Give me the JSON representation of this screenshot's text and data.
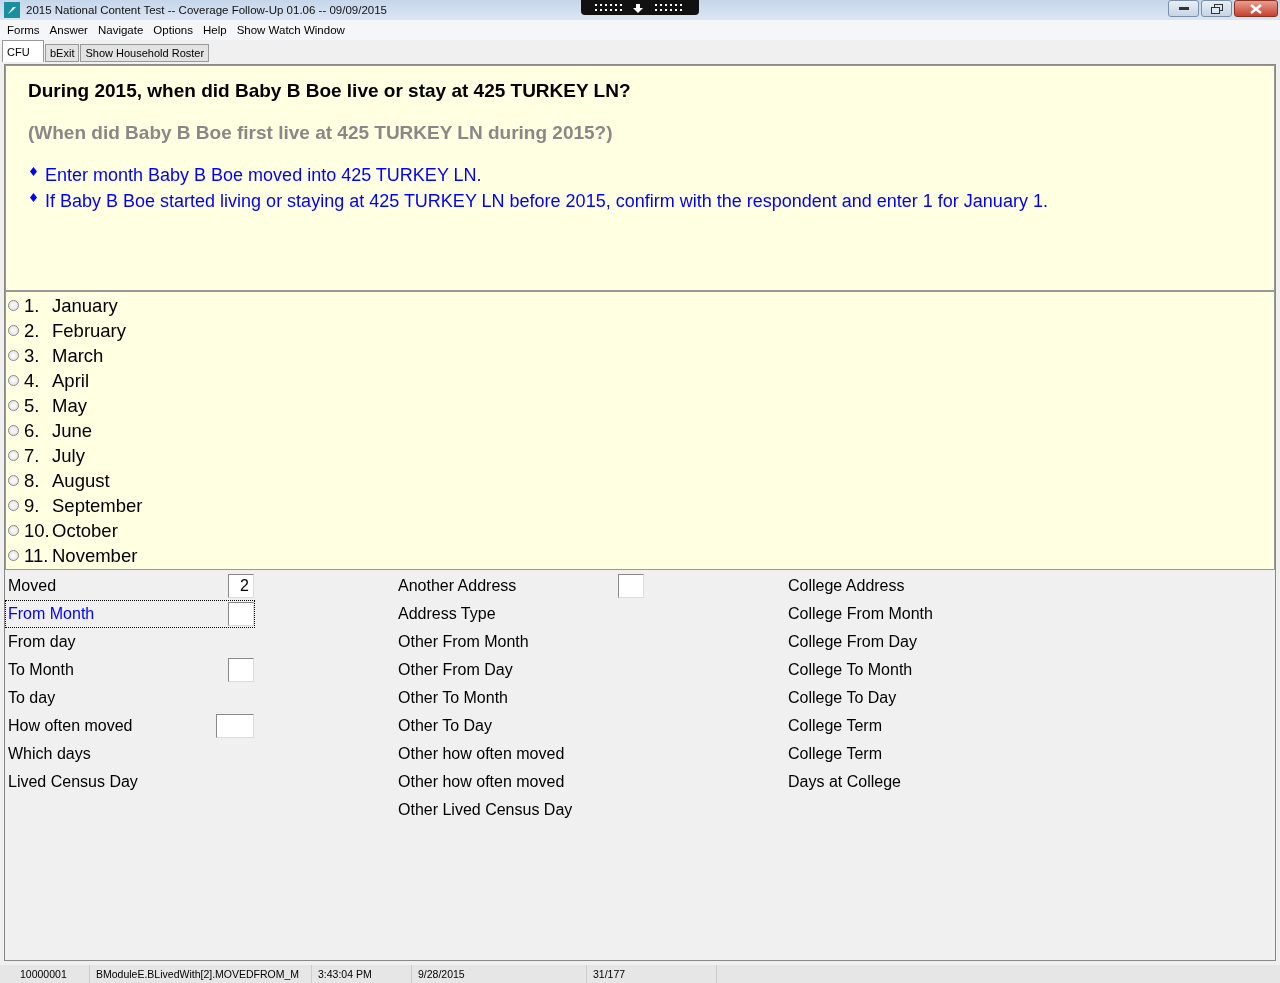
{
  "window": {
    "title": "2015 National Content Test -- Coverage Follow-Up 01.06 -- 09/09/2015"
  },
  "menu": [
    "Forms",
    "Answer",
    "Navigate",
    "Options",
    "Help",
    "Show Watch Window"
  ],
  "tabs": [
    {
      "label": "CFU",
      "selected": true
    },
    {
      "label": "bExit",
      "selected": false
    },
    {
      "label": "Show Household Roster",
      "selected": false
    }
  ],
  "question": {
    "text": "During 2015, when did Baby B Boe live or stay at 425 TURKEY LN?",
    "alternate": "(When did Baby B Boe first live at 425 TURKEY LN during 2015?)",
    "instructions": [
      "Enter month Baby B Boe moved into 425 TURKEY LN.",
      "If Baby B Boe started living or staying at 425 TURKEY LN before 2015, confirm with the respondent and enter 1 for January 1."
    ]
  },
  "options": [
    {
      "number": "1.",
      "label": "January",
      "selected": false
    },
    {
      "number": "2.",
      "label": "February",
      "selected": false
    },
    {
      "number": "3.",
      "label": "March",
      "selected": false
    },
    {
      "number": "4.",
      "label": "April",
      "selected": false
    },
    {
      "number": "5.",
      "label": "May",
      "selected": false
    },
    {
      "number": "6.",
      "label": "June",
      "selected": false
    },
    {
      "number": "7.",
      "label": "July",
      "selected": false
    },
    {
      "number": "8.",
      "label": "August",
      "selected": false
    },
    {
      "number": "9.",
      "label": "September",
      "selected": false
    },
    {
      "number": "10.",
      "label": "October",
      "selected": false
    },
    {
      "number": "11.",
      "label": "November",
      "selected": false
    }
  ],
  "field_columns": [
    [
      {
        "label": "Moved",
        "kind": "short",
        "value": "2",
        "selected": false
      },
      {
        "label": "From Month",
        "kind": "short",
        "selected": true
      },
      {
        "label": "From day",
        "kind": "none",
        "selected": false
      },
      {
        "label": "To Month",
        "kind": "short",
        "selected": false
      },
      {
        "label": "To day",
        "kind": "none",
        "selected": false
      },
      {
        "label": "How often moved",
        "kind": "wide",
        "selected": false
      },
      {
        "label": "Which days",
        "kind": "none",
        "selected": false
      },
      {
        "label": "Lived Census Day",
        "kind": "none",
        "selected": false
      }
    ],
    [
      {
        "label": "Another Address",
        "kind": "short",
        "selected": false
      },
      {
        "label": "Address Type",
        "kind": "none",
        "selected": false
      },
      {
        "label": "Other From Month",
        "kind": "none",
        "selected": false
      },
      {
        "label": "Other From Day",
        "kind": "none",
        "selected": false
      },
      {
        "label": "Other To Month",
        "kind": "none",
        "selected": false
      },
      {
        "label": "Other To Day",
        "kind": "none",
        "selected": false
      },
      {
        "label": "Other how often moved",
        "kind": "none",
        "selected": false
      },
      {
        "label": "Other how often moved",
        "kind": "none",
        "selected": false
      },
      {
        "label": "Other Lived Census Day",
        "kind": "none",
        "selected": false
      }
    ],
    [
      {
        "label": "College Address",
        "kind": "none",
        "selected": false
      },
      {
        "label": "College From Month",
        "kind": "none",
        "selected": false
      },
      {
        "label": "College From Day",
        "kind": "none",
        "selected": false
      },
      {
        "label": "College To Month",
        "kind": "none",
        "selected": false
      },
      {
        "label": "College To Day",
        "kind": "none",
        "selected": false
      },
      {
        "label": "College Term",
        "kind": "none",
        "selected": false
      },
      {
        "label": "College Term",
        "kind": "none",
        "selected": false
      },
      {
        "label": "Days at College",
        "kind": "none",
        "selected": false
      }
    ]
  ],
  "status_bar": [
    "10000001",
    "BModuleE.BLivedWith[2].MOVEDFROM_M",
    "3:43:04 PM",
    "9/28/2015",
    "31/177"
  ]
}
